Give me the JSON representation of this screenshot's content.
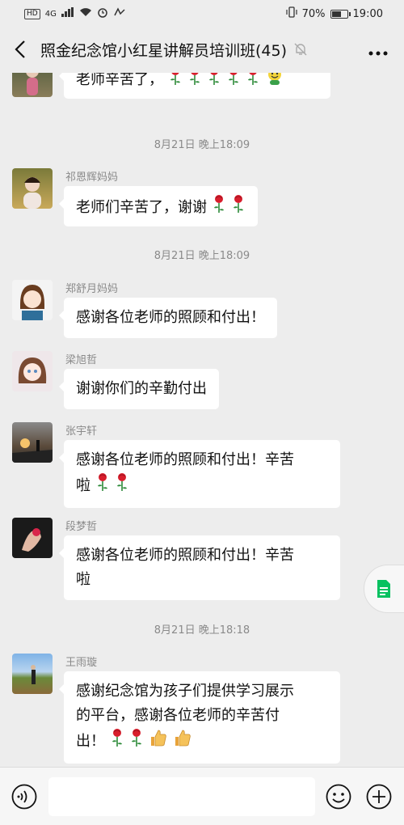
{
  "status_bar": {
    "hd": "HD",
    "network": "4G",
    "battery": "70%",
    "battery_level": 0.7,
    "time": "19:00"
  },
  "header": {
    "title": "照金纪念馆小红星讲解员培训班(45)",
    "back_icon": "chevron-left-icon",
    "mute_icon": "bell-muted-icon",
    "more_icon": "more-dots-icon"
  },
  "messages": [
    {
      "type": "msg",
      "sender": "",
      "text": "老师辛苦了，",
      "emojis": [
        "rose",
        "rose",
        "rose",
        "rose",
        "rose",
        "smiley-face"
      ]
    },
    {
      "type": "time",
      "text": "8月21日 晚上18:09"
    },
    {
      "type": "msg",
      "sender": "祁恩辉妈妈",
      "text": "老师们辛苦了，谢谢",
      "emojis": [
        "rose",
        "rose"
      ]
    },
    {
      "type": "time",
      "text": "8月21日 晚上18:09"
    },
    {
      "type": "msg",
      "sender": "郑舒月妈妈",
      "text": "感谢各位老师的照顾和付出！",
      "emojis": []
    },
    {
      "type": "msg",
      "sender": "梁旭哲",
      "text": "谢谢你们的辛勤付出",
      "emojis": []
    },
    {
      "type": "msg",
      "sender": "张宇轩",
      "text_lines": [
        "感谢各位老师的照顾和付出！辛苦",
        "啦"
      ],
      "emojis": [
        "rose",
        "rose"
      ]
    },
    {
      "type": "msg",
      "sender": "段梦哲",
      "text_lines": [
        "感谢各位老师的照顾和付出！辛苦",
        "啦"
      ],
      "emojis": []
    },
    {
      "type": "time",
      "text": "8月21日 晚上18:18"
    },
    {
      "type": "msg",
      "sender": "王雨璇",
      "text_lines": [
        "感谢纪念馆为孩子们提供学习展示",
        "的平台，感谢各位老师的辛苦付",
        "出！"
      ],
      "emojis": [
        "rose",
        "rose",
        "thumbs-up",
        "thumbs-up"
      ]
    }
  ],
  "input_bar": {
    "voice_icon": "voice-icon",
    "emoji_icon": "emoji-icon",
    "plus_icon": "plus-icon",
    "text_value": ""
  },
  "float_icon": "document-icon",
  "colors": {
    "background": "#ededed",
    "bubble": "#ffffff",
    "time_text": "#8a8a8a",
    "rose": "#d81e2c",
    "leaf": "#2e8b3a",
    "doc_green": "#07c160"
  }
}
